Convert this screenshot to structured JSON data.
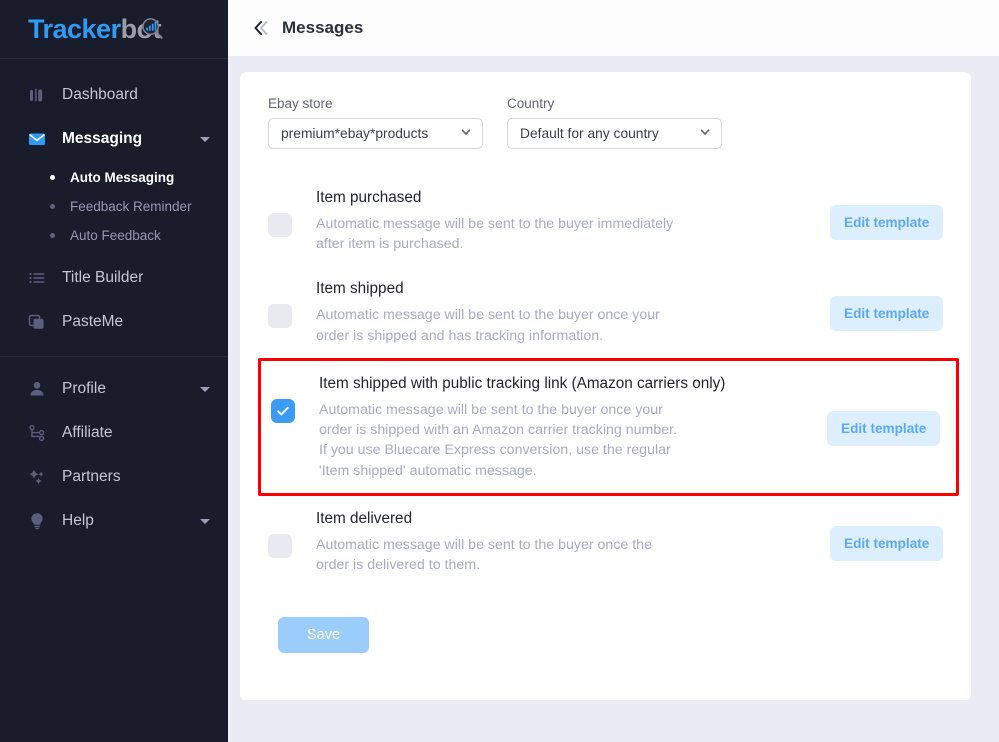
{
  "brand": {
    "name_part1": "Tracker",
    "name_part2": "bot",
    "accent": "#2f9bf5",
    "muted": "#9b9ea8"
  },
  "sidebar": {
    "items": [
      {
        "label": "Dashboard",
        "icon": "bar-chart-icon",
        "active": false,
        "caret": false
      },
      {
        "label": "Messaging",
        "icon": "envelope-icon",
        "active": true,
        "caret": true
      },
      {
        "label": "Title Builder",
        "icon": "list-icon",
        "active": false,
        "caret": false
      },
      {
        "label": "PasteMe",
        "icon": "copy-icon",
        "active": false,
        "caret": false
      },
      {
        "label": "Profile",
        "icon": "user-icon",
        "active": false,
        "caret": true
      },
      {
        "label": "Affiliate",
        "icon": "share-nodes-icon",
        "active": false,
        "caret": false
      },
      {
        "label": "Partners",
        "icon": "sparkle-icon",
        "active": false,
        "caret": false
      },
      {
        "label": "Help",
        "icon": "lightbulb-icon",
        "active": false,
        "caret": true
      }
    ],
    "messaging_submenu": [
      {
        "label": "Auto Messaging",
        "active": true
      },
      {
        "label": "Feedback Reminder",
        "active": false
      },
      {
        "label": "Auto Feedback",
        "active": false
      }
    ]
  },
  "header": {
    "title": "Messages",
    "back_icon": "double-chevron-left-icon"
  },
  "filters": {
    "ebay_store": {
      "label": "Ebay store",
      "value": "premium*ebay*products"
    },
    "country": {
      "label": "Country",
      "value": "Default for any country"
    }
  },
  "messages": [
    {
      "title": "Item purchased",
      "desc_lines": [
        "Automatic message will be sent to the buyer immediately",
        "after item is purchased."
      ],
      "checked": false,
      "highlighted": false,
      "edit_label": "Edit template"
    },
    {
      "title": "Item shipped",
      "desc_lines": [
        "Automatic message will be sent to the buyer once your",
        "order is shipped and has tracking information."
      ],
      "checked": false,
      "highlighted": false,
      "edit_label": "Edit template"
    },
    {
      "title": "Item shipped with public tracking link (Amazon carriers only)",
      "desc_lines": [
        "Automatic message will be sent to the buyer once your",
        "order is shipped with an Amazon carrier tracking number.",
        "If you use Bluecare Express conversion, use the regular",
        "'Item shipped' automatic message."
      ],
      "checked": true,
      "highlighted": true,
      "edit_label": "Edit template"
    },
    {
      "title": "Item delivered",
      "desc_lines": [
        "Automatic message will be sent to the buyer once the",
        "order is delivered to them."
      ],
      "checked": false,
      "highlighted": false,
      "edit_label": "Edit template"
    }
  ],
  "actions": {
    "save_label": "Save"
  },
  "colors": {
    "checkbox_checked": "#3b9bf5",
    "checkbox_unchecked": "#e9eaf0",
    "edit_button_bg": "#ddeeff",
    "edit_button_text": "#5aa9f8",
    "save_button_bg": "#9bcdfa",
    "highlight_border": "#fa0000",
    "sidebar_bg": "#191c2b",
    "page_bg": "#ebebf3"
  }
}
